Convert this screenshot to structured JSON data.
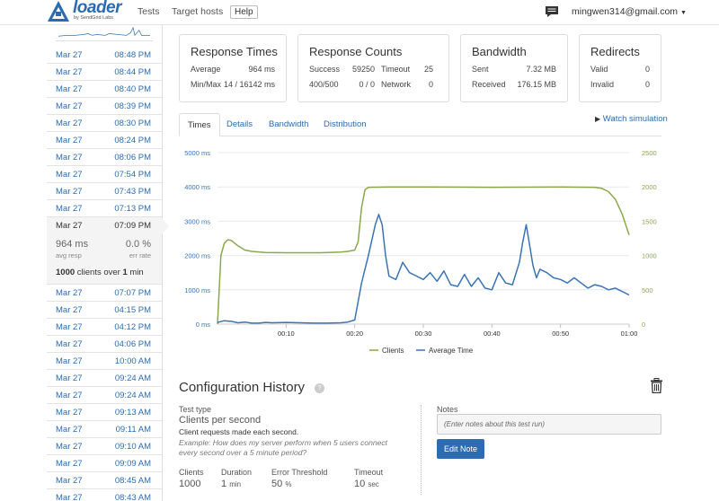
{
  "brand": {
    "name": "loader",
    "sub": "by SendGrid Labs",
    "color": "#2b6cb0"
  },
  "nav": {
    "tests": "Tests",
    "target_hosts": "Target hosts",
    "help": "Help",
    "user": "mingwen314@gmail.com"
  },
  "sidebar": {
    "rows_before": [
      {
        "date": "Mar 27",
        "time": "08:48 PM"
      },
      {
        "date": "Mar 27",
        "time": "08:44 PM"
      },
      {
        "date": "Mar 27",
        "time": "08:40 PM"
      },
      {
        "date": "Mar 27",
        "time": "08:39 PM"
      },
      {
        "date": "Mar 27",
        "time": "08:30 PM"
      },
      {
        "date": "Mar 27",
        "time": "08:24 PM"
      },
      {
        "date": "Mar 27",
        "time": "08:06 PM"
      },
      {
        "date": "Mar 27",
        "time": "07:54 PM"
      },
      {
        "date": "Mar 27",
        "time": "07:43 PM"
      },
      {
        "date": "Mar 27",
        "time": "07:13 PM"
      }
    ],
    "active": {
      "date": "Mar 27",
      "time": "07:09 PM",
      "avg_resp": "964 ms",
      "avg_resp_label": "avg resp",
      "err_rate": "0.0 %",
      "err_rate_label": "err rate",
      "clients_num": "1000",
      "clients_mid": " clients over ",
      "clients_dur": "1",
      "clients_unit": " min"
    },
    "rows_after": [
      {
        "date": "Mar 27",
        "time": "07:07 PM"
      },
      {
        "date": "Mar 27",
        "time": "04:15 PM"
      },
      {
        "date": "Mar 27",
        "time": "04:12 PM"
      },
      {
        "date": "Mar 27",
        "time": "04:06 PM"
      },
      {
        "date": "Mar 27",
        "time": "10:00 AM"
      },
      {
        "date": "Mar 27",
        "time": "09:24 AM"
      },
      {
        "date": "Mar 27",
        "time": "09:24 AM"
      },
      {
        "date": "Mar 27",
        "time": "09:13 AM"
      },
      {
        "date": "Mar 27",
        "time": "09:11 AM"
      },
      {
        "date": "Mar 27",
        "time": "09:10 AM"
      },
      {
        "date": "Mar 27",
        "time": "09:09 AM"
      },
      {
        "date": "Mar 27",
        "time": "08:45 AM"
      },
      {
        "date": "Mar 27",
        "time": "08:43 AM"
      }
    ]
  },
  "cards": {
    "response_times": {
      "title": "Response Times",
      "average_label": "Average",
      "average": "964 ms",
      "minmax_label": "Min/Max",
      "minmax": "14 / 16142 ms"
    },
    "response_counts": {
      "title": "Response Counts",
      "success_label": "Success",
      "success": "59250",
      "timeout_label": "Timeout",
      "timeout": "25",
      "err_label": "400/500",
      "err": "0 / 0",
      "network_label": "Network",
      "network": "0"
    },
    "bandwidth": {
      "title": "Bandwidth",
      "sent_label": "Sent",
      "sent": "7.32 MB",
      "received_label": "Received",
      "received": "176.15 MB"
    },
    "redirects": {
      "title": "Redirects",
      "valid_label": "Valid",
      "valid": "0",
      "invalid_label": "Invalid",
      "invalid": "0"
    }
  },
  "tabs": [
    "Times",
    "Details",
    "Bandwidth",
    "Distribution"
  ],
  "watch_label": "Watch simulation",
  "chart_data": {
    "type": "line",
    "y_left_ticks": [
      "0 ms",
      "1000 ms",
      "2000 ms",
      "3000 ms",
      "4000 ms",
      "5000 ms"
    ],
    "y_right_ticks": [
      "0",
      "500",
      "1000",
      "1500",
      "2000",
      "2500"
    ],
    "x_ticks": [
      "00:10",
      "00:20",
      "00:30",
      "00:40",
      "00:50",
      "01:00"
    ],
    "ylim_left": [
      0,
      5000
    ],
    "ylim_right": [
      0,
      2500
    ],
    "xlim": [
      0,
      60
    ],
    "grid": true,
    "legend": "bottom",
    "series": [
      {
        "name": "Clients",
        "color": "#8aa84a",
        "axis": "right",
        "x": [
          0,
          0.5,
          1,
          1.5,
          2,
          3,
          4,
          5,
          7,
          10,
          15,
          18,
          19,
          20,
          20.5,
          21,
          21.5,
          22,
          25,
          30,
          40,
          50,
          55,
          56,
          57,
          58,
          59,
          60
        ],
        "y": [
          0,
          1000,
          1180,
          1230,
          1220,
          1140,
          1080,
          1060,
          1045,
          1040,
          1040,
          1050,
          1060,
          1080,
          1200,
          1700,
          1960,
          1995,
          2000,
          2000,
          1995,
          2000,
          1995,
          1980,
          1930,
          1820,
          1600,
          1300
        ]
      },
      {
        "name": "Average Time",
        "color": "#3a74b4",
        "axis": "left",
        "x": [
          0,
          1,
          2,
          3,
          4,
          5,
          6,
          7,
          8,
          10,
          12,
          14,
          16,
          18,
          19,
          20,
          21,
          22,
          23,
          23.5,
          24,
          24.5,
          25,
          26,
          27,
          28,
          29,
          30,
          31,
          32,
          33,
          34,
          35,
          36,
          37,
          38,
          39,
          40,
          41,
          42,
          43,
          44,
          44.5,
          45,
          46,
          46.5,
          47,
          48,
          49,
          50,
          51,
          52,
          53,
          54,
          55,
          56,
          57,
          58,
          59,
          60
        ],
        "y": [
          50,
          100,
          80,
          40,
          60,
          30,
          30,
          50,
          40,
          50,
          40,
          30,
          30,
          40,
          60,
          120,
          1200,
          2000,
          2900,
          3200,
          2900,
          2000,
          1400,
          1300,
          1800,
          1500,
          1400,
          1300,
          1500,
          1250,
          1550,
          1150,
          1100,
          1450,
          1100,
          1350,
          1050,
          1000,
          1500,
          1200,
          1150,
          1800,
          2400,
          2900,
          1700,
          1350,
          1600,
          1500,
          1350,
          1300,
          1200,
          1350,
          1200,
          1050,
          1150,
          1100,
          1000,
          1050,
          950,
          850
        ]
      }
    ]
  },
  "config": {
    "title": "Configuration History",
    "help_mark": "?",
    "test_type_label": "Test type",
    "test_type": "Clients per second",
    "test_type_desc": "Client requests made each second.",
    "example": "Example: How does my server perform when 5 users connect every second over a 5 minute period?",
    "clients_label": "Clients",
    "clients": "1000",
    "duration_label": "Duration",
    "duration": "1",
    "duration_unit": "min",
    "error_label": "Error Threshold",
    "error": "50",
    "error_unit": "%",
    "timeout_label": "Timeout",
    "timeout": "10",
    "timeout_unit": "sec",
    "notes_label": "Notes",
    "notes_placeholder": "(Enter notes about this test run)",
    "edit_note": "Edit Note"
  }
}
